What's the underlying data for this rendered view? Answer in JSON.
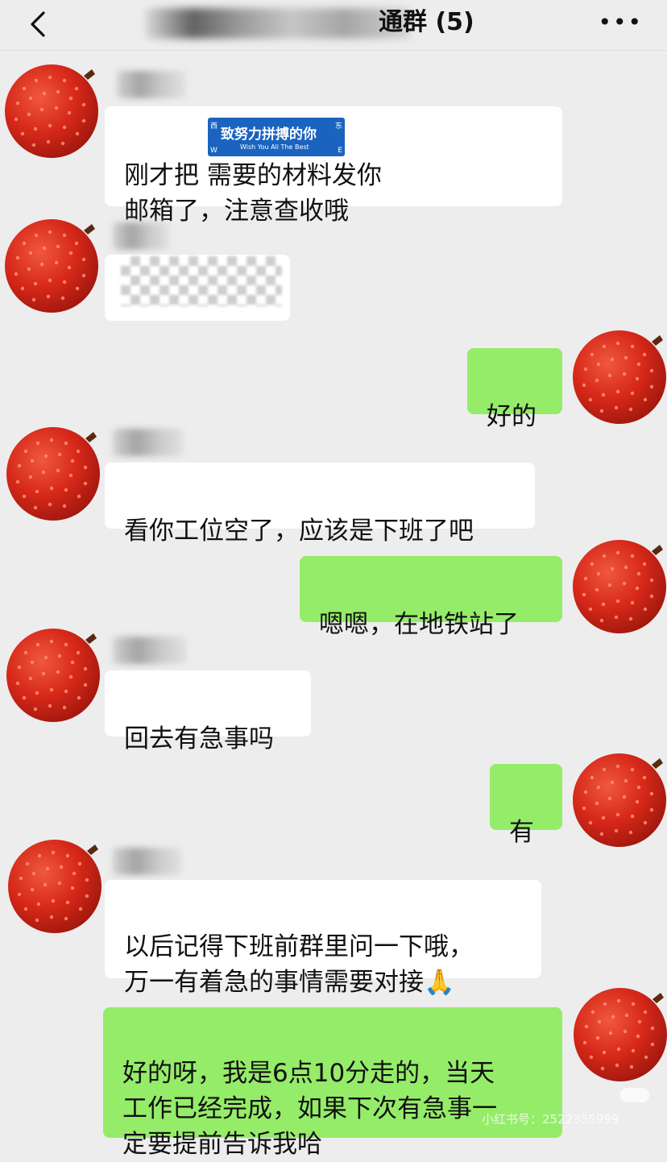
{
  "header": {
    "title": "通群 (5)",
    "more": "•••"
  },
  "messages": [
    {
      "side": "left",
      "text": "刚才把          需要的材料发你\n邮箱了，注意查收哦",
      "sticker": {
        "main": "致努力拼搏的你",
        "sub": "Wish You All The Best",
        "corner_tl": "西",
        "corner_tr": "东",
        "corner_bl": "W",
        "corner_br": "E"
      }
    },
    {
      "side": "left",
      "text": ""
    },
    {
      "side": "right",
      "text": "好的"
    },
    {
      "side": "left",
      "text": "看你工位空了，应该是下班了吧"
    },
    {
      "side": "right",
      "text": "嗯嗯，在地铁站了"
    },
    {
      "side": "left",
      "text": "回去有急事吗"
    },
    {
      "side": "right",
      "text": "有"
    },
    {
      "side": "left",
      "text": "以后记得下班前群里问一下哦，\n万一有着急的事情需要对接🙏"
    },
    {
      "side": "right",
      "text": "好的呀，我是6点10分走的，当天\n工作已经完成，如果下次有急事一\n定要提前告诉我哈"
    }
  ],
  "watermark": "小红书号：2522355999",
  "colors": {
    "bg": "#ededed",
    "incoming": "#ffffff",
    "outgoing": "#95ec69",
    "avatar": "#d42a20"
  }
}
